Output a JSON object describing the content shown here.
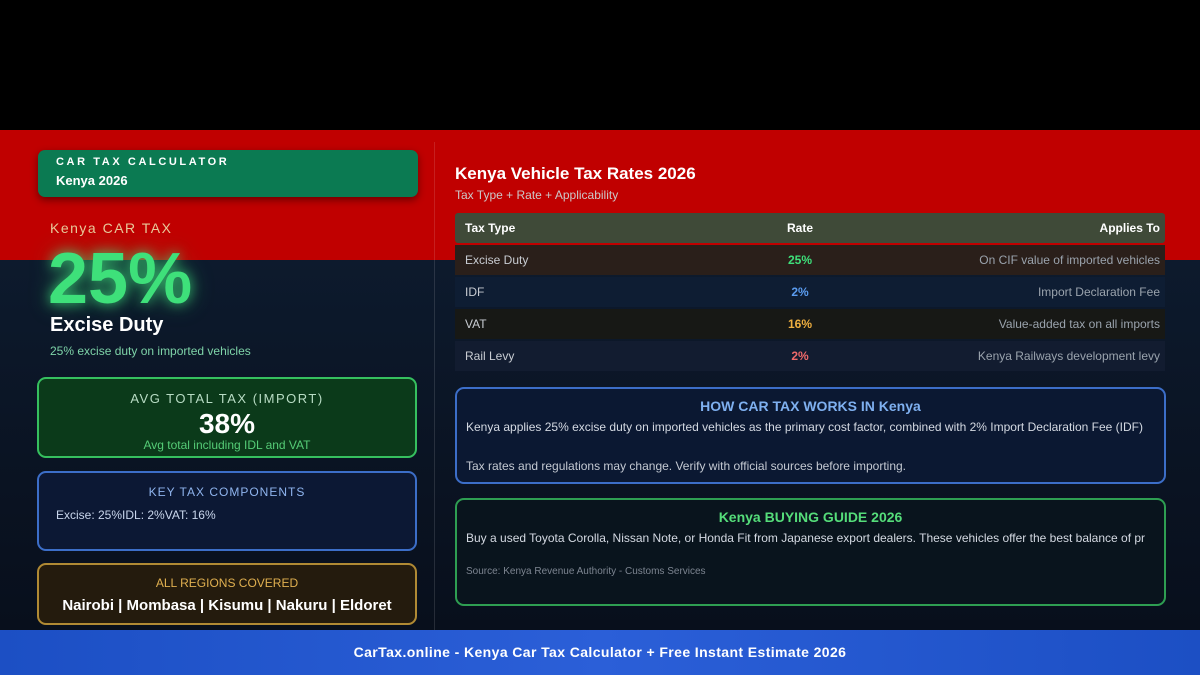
{
  "colors": {
    "red_band": "#c00000",
    "navy_bg": "#0d1a2d",
    "badge_green": "#0b7a52",
    "accent_green": "#3ee07a",
    "accent_blue": "#3c6ec8",
    "accent_gold": "#b08a34",
    "footer_blue": "#2b5fd8"
  },
  "badge": {
    "line1": "CAR TAX CALCULATOR",
    "line2": "Kenya 2026"
  },
  "hero": {
    "label": "Kenya CAR TAX",
    "rate": "25%",
    "heading": "Excise Duty",
    "subtext": "25% excise duty on imported vehicles"
  },
  "avg_card": {
    "title": "AVG TOTAL TAX (IMPORT)",
    "value": "38%",
    "subtext": "Avg total including IDL and VAT"
  },
  "key_card": {
    "title": "KEY TAX COMPONENTS",
    "value": "Excise: 25%IDL: 2%VAT: 16%"
  },
  "region_card": {
    "title": "ALL REGIONS COVERED",
    "value": "Nairobi | Mombasa | Kisumu | Nakuru | Eldoret"
  },
  "rates": {
    "title": "Kenya Vehicle Tax Rates 2026",
    "subtitle": "Tax Type + Rate + Applicability",
    "headers": [
      "Tax Type",
      "Rate",
      "Applies To"
    ],
    "rows": [
      {
        "type": "Excise Duty",
        "rate": "25%",
        "applies": "On CIF value of imported vehicles",
        "rate_color": "#3ee07a"
      },
      {
        "type": "IDF",
        "rate": "2%",
        "applies": "Import Declaration Fee",
        "rate_color": "#5b9cf0"
      },
      {
        "type": "VAT",
        "rate": "16%",
        "applies": "Value-added tax on all imports",
        "rate_color": "#f0b040"
      },
      {
        "type": "Rail Levy",
        "rate": "2%",
        "applies": "Kenya Railways development levy",
        "rate_color": "#f06a6a"
      }
    ]
  },
  "how_card": {
    "title": "HOW CAR TAX WORKS IN Kenya",
    "para1": "Kenya applies 25% excise duty on imported vehicles as the primary cost factor, combined with 2% Import Declaration Fee (IDF)",
    "para2": "Tax rates and regulations may change. Verify with official sources before importing."
  },
  "guide_card": {
    "title": "Kenya BUYING GUIDE 2026",
    "para1": "Buy a used Toyota Corolla, Nissan Note, or Honda Fit from Japanese export dealers. These vehicles offer the best balance of pr",
    "source": "Source: Kenya Revenue Authority - Customs Services"
  },
  "footer": {
    "text": "CarTax.online - Kenya Car Tax Calculator + Free Instant Estimate 2026"
  }
}
